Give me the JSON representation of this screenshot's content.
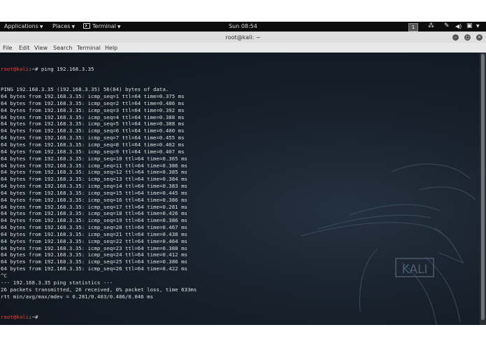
{
  "topbar": {
    "applications": "Applications",
    "places": "Places",
    "terminal": "Terminal",
    "clock": "Sun 08:54",
    "workspace": "1",
    "icons": [
      "network-icon",
      "pen-icon",
      "volume-icon",
      "battery-icon",
      "power-icon"
    ]
  },
  "window": {
    "title": "root@kali: ~",
    "menu": [
      "File",
      "Edit",
      "View",
      "Search",
      "Terminal",
      "Help"
    ]
  },
  "terminal": {
    "prompt_user": "root@kali",
    "prompt_path": ":~# ",
    "command": "ping 192.168.3.35",
    "output": [
      "PING 192.168.3.35 (192.168.3.35) 56(84) bytes of data.",
      "64 bytes from 192.168.3.35: icmp_seq=1 ttl=64 time=0.375 ms",
      "64 bytes from 192.168.3.35: icmp_seq=2 ttl=64 time=0.486 ms",
      "64 bytes from 192.168.3.35: icmp_seq=3 ttl=64 time=0.392 ms",
      "64 bytes from 192.168.3.35: icmp_seq=4 ttl=64 time=0.388 ms",
      "64 bytes from 192.168.3.35: icmp_seq=5 ttl=64 time=0.388 ms",
      "64 bytes from 192.168.3.35: icmp_seq=6 ttl=64 time=0.400 ms",
      "64 bytes from 192.168.3.35: icmp_seq=7 ttl=64 time=0.455 ms",
      "64 bytes from 192.168.3.35: icmp_seq=8 ttl=64 time=0.402 ms",
      "64 bytes from 192.168.3.35: icmp_seq=9 ttl=64 time=0.407 ms",
      "64 bytes from 192.168.3.35: icmp_seq=10 ttl=64 time=0.365 ms",
      "64 bytes from 192.168.3.35: icmp_seq=11 ttl=64 time=0.386 ms",
      "64 bytes from 192.168.3.35: icmp_seq=12 ttl=64 time=0.385 ms",
      "64 bytes from 192.168.3.35: icmp_seq=13 ttl=64 time=0.384 ms",
      "64 bytes from 192.168.3.35: icmp_seq=14 ttl=64 time=0.383 ms",
      "64 bytes from 192.168.3.35: icmp_seq=15 ttl=64 time=0.445 ms",
      "64 bytes from 192.168.3.35: icmp_seq=16 ttl=64 time=0.386 ms",
      "64 bytes from 192.168.3.35: icmp_seq=17 ttl=64 time=0.281 ms",
      "64 bytes from 192.168.3.35: icmp_seq=18 ttl=64 time=0.426 ms",
      "64 bytes from 192.168.3.35: icmp_seq=19 ttl=64 time=0.386 ms",
      "64 bytes from 192.168.3.35: icmp_seq=20 ttl=64 time=0.467 ms",
      "64 bytes from 192.168.3.35: icmp_seq=21 ttl=64 time=0.438 ms",
      "64 bytes from 192.168.3.35: icmp_seq=22 ttl=64 time=0.464 ms",
      "64 bytes from 192.168.3.35: icmp_seq=23 ttl=64 time=0.388 ms",
      "64 bytes from 192.168.3.35: icmp_seq=24 ttl=64 time=0.412 ms",
      "64 bytes from 192.168.3.35: icmp_seq=25 ttl=64 time=0.386 ms",
      "64 bytes from 192.168.3.35: icmp_seq=26 ttl=64 time=0.422 ms",
      "^C",
      "--- 192.168.3.35 ping statistics ---",
      "26 packets transmitted, 26 received, 0% packet loss, time 633ms",
      "rtt min/avg/max/mdev = 0.281/0.403/0.486/0.046 ms"
    ],
    "wallpaper_logo": "KALI"
  },
  "colors": {
    "prompt_user": "#ff3c3c",
    "terminal_text": "#dfdfdf",
    "terminal_bg": "#17202b"
  }
}
